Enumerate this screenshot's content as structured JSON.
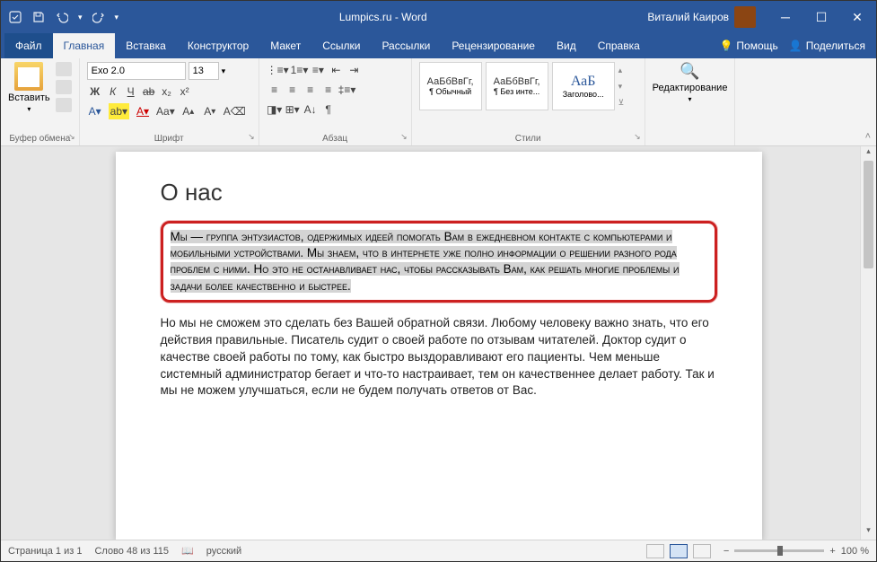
{
  "titlebar": {
    "title": "Lumpics.ru - Word",
    "user": "Виталий Каиров"
  },
  "tabs": {
    "file": "Файл",
    "items": [
      "Главная",
      "Вставка",
      "Конструктор",
      "Макет",
      "Ссылки",
      "Рассылки",
      "Рецензирование",
      "Вид",
      "Справка"
    ],
    "help": "Помощь",
    "share": "Поделиться"
  },
  "ribbon": {
    "clipboard": {
      "paste": "Вставить",
      "label": "Буфер обмена"
    },
    "font": {
      "name": "Exo 2.0",
      "size": "13",
      "label": "Шрифт"
    },
    "paragraph": {
      "label": "Абзац"
    },
    "styles": {
      "label": "Стили",
      "items": [
        {
          "preview": "АаБбВвГг,",
          "name": "¶ Обычный"
        },
        {
          "preview": "АаБбВвГг,",
          "name": "¶ Без инте..."
        },
        {
          "preview": "АаБ",
          "name": "Заголово..."
        }
      ]
    },
    "editing": {
      "label": "Редактирование"
    }
  },
  "document": {
    "heading": "О нас",
    "selected": "Мы — группа энтузиастов, одержимых идеей помогать Вам в ежедневном контакте с компьютерами и мобильными устройствами. Мы знаем, что в интернете уже полно информации о решении разного рода проблем с ними. Но это не останавливает нас, чтобы рассказывать Вам, как решать многие проблемы и задачи более качественно и быстрее.",
    "para2": "Но мы не сможем это сделать без Вашей обратной связи. Любому человеку важно знать, что его действия правильные. Писатель судит о своей работе по отзывам читателей. Доктор судит о качестве своей работы по тому, как быстро выздоравливают его пациенты. Чем меньше системный администратор бегает и что-то настраивает, тем он качественнее делает работу. Так и мы не можем улучшаться, если не будем получать ответов от Вас."
  },
  "statusbar": {
    "page": "Страница 1 из 1",
    "words": "Слово 48 из 115",
    "lang": "русский",
    "zoom": "100 %"
  }
}
